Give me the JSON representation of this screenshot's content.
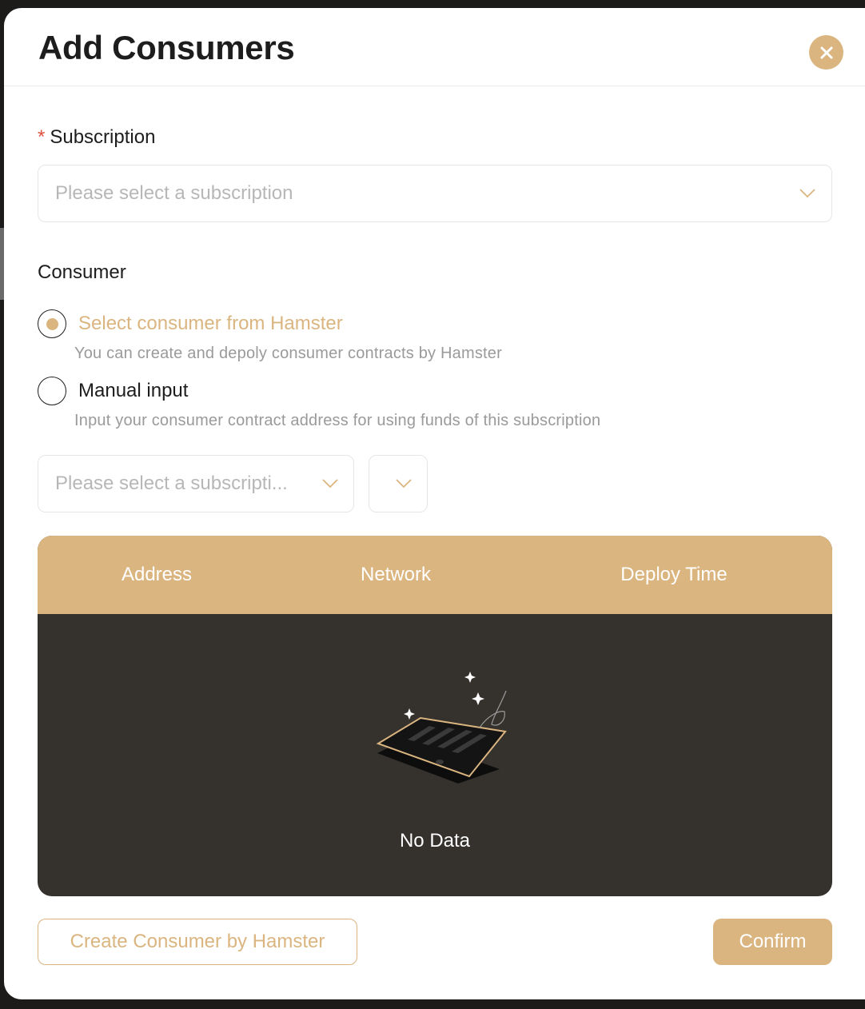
{
  "modal": {
    "title": "Add Consumers"
  },
  "subscription": {
    "label": "Subscription",
    "required_mark": "*",
    "placeholder": "Please select a subscription"
  },
  "consumer": {
    "label": "Consumer",
    "options": [
      {
        "label": "Select consumer from Hamster",
        "description": "You can create and depoly consumer contracts by Hamster",
        "selected": true
      },
      {
        "label": "Manual input",
        "description": "Input your consumer contract address for using funds of this subscription",
        "selected": false
      }
    ],
    "filter_placeholder": "Please select a subscripti..."
  },
  "table": {
    "columns": [
      "Address",
      "Network",
      "Deploy Time"
    ],
    "rows": [],
    "empty_text": "No Data"
  },
  "footer": {
    "create_label": "Create Consumer by Hamster",
    "confirm_label": "Confirm"
  },
  "colors": {
    "accent": "#dbb580",
    "table_body": "#35322e",
    "required": "#e0503e"
  }
}
